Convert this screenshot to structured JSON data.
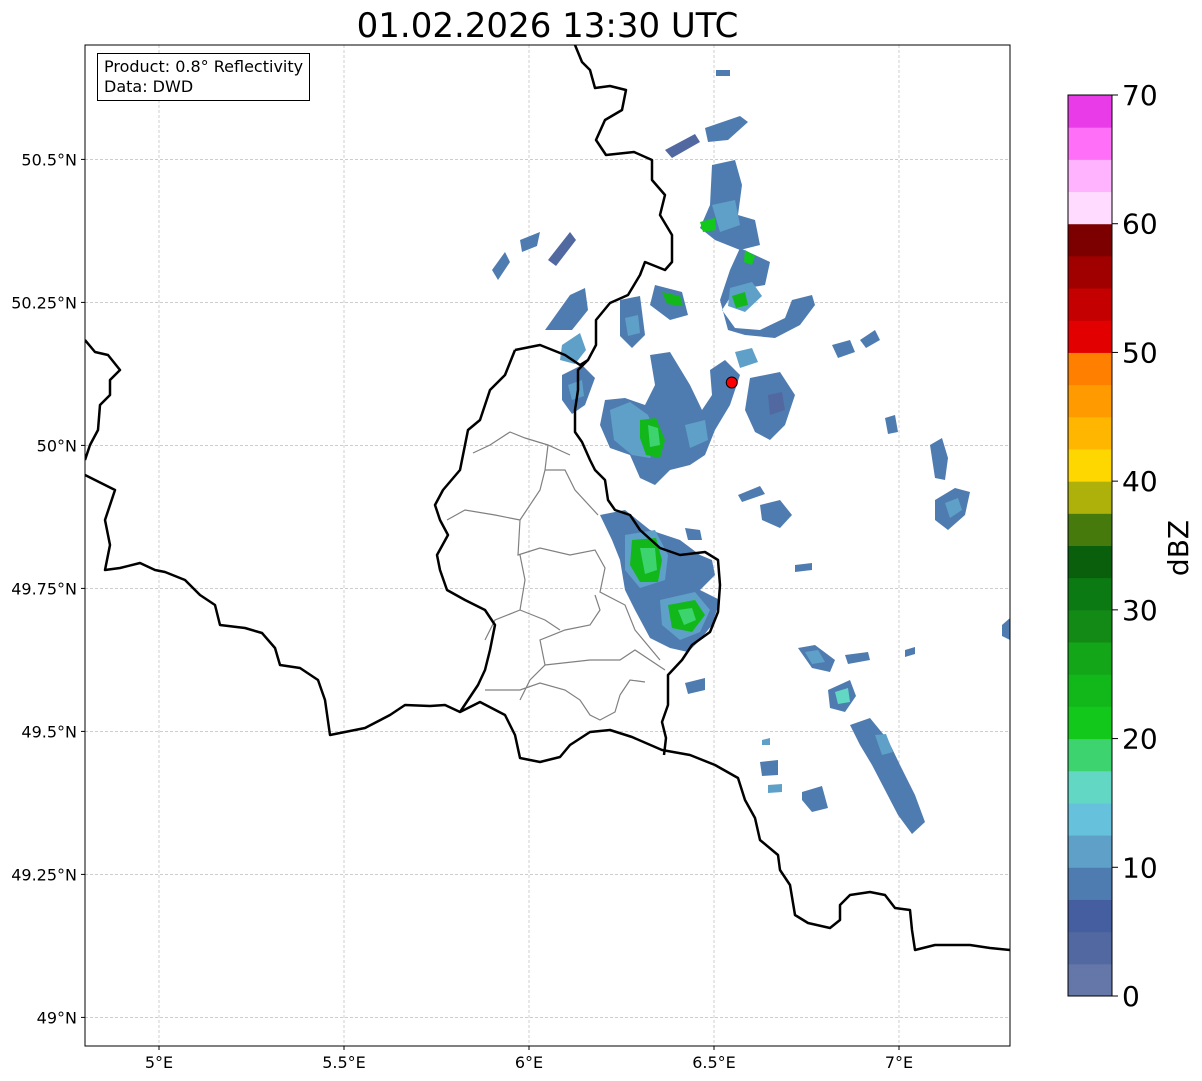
{
  "title": "01.02.2026 13:30 UTC",
  "info": {
    "product": "Product: 0.8° Reflectivity",
    "data_source": "Data: DWD"
  },
  "map": {
    "lon_range": [
      4.8,
      7.3
    ],
    "lat_range": [
      48.95,
      50.7
    ],
    "x_ticks": [
      {
        "value": 5.0,
        "label": "5°E"
      },
      {
        "value": 5.5,
        "label": "5.5°E"
      },
      {
        "value": 6.0,
        "label": "6°E"
      },
      {
        "value": 6.5,
        "label": "6.5°E"
      },
      {
        "value": 7.0,
        "label": "7°E"
      }
    ],
    "y_ticks": [
      {
        "value": 49.0,
        "label": "49°N"
      },
      {
        "value": 49.25,
        "label": "49.25°N"
      },
      {
        "value": 49.5,
        "label": "49.5°N"
      },
      {
        "value": 49.75,
        "label": "49.75°N"
      },
      {
        "value": 50.0,
        "label": "50°N"
      },
      {
        "value": 50.25,
        "label": "50.25°N"
      },
      {
        "value": 50.5,
        "label": "50.5°N"
      }
    ],
    "grid": true,
    "radar_site": {
      "lon": 6.548,
      "lat": 50.11,
      "color": "#ff0000"
    }
  },
  "colorbar": {
    "label": "dBZ",
    "min": 0,
    "max": 70,
    "step": 2.5,
    "ticks": [
      0,
      10,
      20,
      30,
      40,
      50,
      60,
      70
    ],
    "colors": [
      "#6577a9",
      "#5268a0",
      "#445ea0",
      "#4f7cb0",
      "#5fa0c8",
      "#66c2dc",
      "#62d8c4",
      "#3dd36f",
      "#12c81a",
      "#12b81a",
      "#12a618",
      "#138a16",
      "#0c7a12",
      "#095f0c",
      "#467a0c",
      "#aeb10a",
      "#ffd700",
      "#ffb600",
      "#ff9b00",
      "#ff7f00",
      "#e30000",
      "#c40000",
      "#a10000",
      "#7d0000",
      "#ffdcff",
      "#ffb3ff",
      "#ff6ff8",
      "#e93ce8"
    ]
  }
}
